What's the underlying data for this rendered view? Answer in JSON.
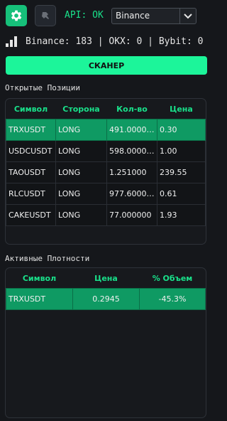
{
  "toolbar": {
    "settings_icon": "gear-icon",
    "pin_icon": "pin-icon",
    "api_status": "API: OK",
    "exchange_selected": "Binance",
    "accent": "#16c07a"
  },
  "stats": {
    "text": "Binance: 183 | OKX: 0 | Bybit: 0"
  },
  "scanner_button": {
    "label": "СКАНЕР"
  },
  "positions": {
    "title": "Открытые Позиции",
    "columns": [
      "Символ",
      "Сторона",
      "Кол-во",
      "Цена"
    ],
    "rows": [
      [
        "TRXUSDT",
        "LONG",
        "491.0000…",
        "0.30"
      ],
      [
        "USDCUSDT",
        "LONG",
        "598.0000…",
        "1.00"
      ],
      [
        "TAOUSDT",
        "LONG",
        "1.251000",
        "239.55"
      ],
      [
        "RLCUSDT",
        "LONG",
        "977.6000…",
        "0.61"
      ],
      [
        "CAKEUSDT",
        "LONG",
        "77.000000",
        "1.93"
      ]
    ]
  },
  "densities": {
    "title": "Активные Плотности",
    "columns": [
      "Символ",
      "Цена",
      "% Объем"
    ],
    "rows": [
      [
        "TRXUSDT",
        "0.2945",
        "-45.3%"
      ]
    ]
  }
}
